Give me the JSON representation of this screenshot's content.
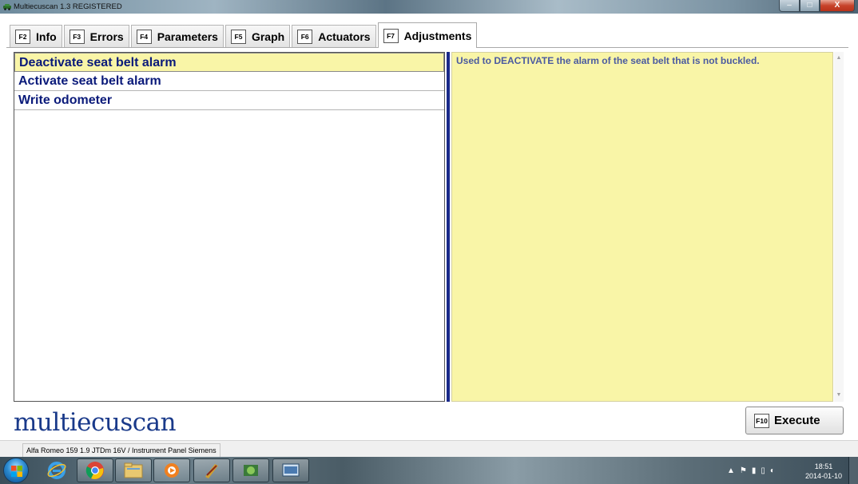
{
  "window": {
    "title": "Multiecuscan 1.3 REGISTERED",
    "minimize": "–",
    "maximize": "□",
    "close": "X"
  },
  "tabs": [
    {
      "key": "F2",
      "label": "Info"
    },
    {
      "key": "F3",
      "label": "Errors"
    },
    {
      "key": "F4",
      "label": "Parameters"
    },
    {
      "key": "F5",
      "label": "Graph"
    },
    {
      "key": "F6",
      "label": "Actuators"
    },
    {
      "key": "F7",
      "label": "Adjustments",
      "active": true
    }
  ],
  "adjustments": [
    {
      "label": "Deactivate seat belt alarm",
      "selected": true
    },
    {
      "label": "Activate seat belt alarm"
    },
    {
      "label": "Write odometer"
    }
  ],
  "description": "Used to DEACTIVATE the alarm of the seat belt that is not buckled.",
  "logo": "multiecuscan",
  "execute": {
    "key": "F10",
    "label": "Execute"
  },
  "status": {
    "vehicle": "Alfa Romeo 159 1.9 JTDm 16V / Instrument Panel Siemens"
  },
  "taskbar": {
    "items": [
      "internet-explorer-icon",
      "chrome-icon",
      "file-explorer-icon",
      "media-player-icon",
      "app-icon",
      "app-icon",
      "app-icon"
    ],
    "clock": {
      "time": "18:51",
      "date": "2014-01-10"
    }
  },
  "colors": {
    "selection": "#f9f5a7",
    "list_text": "#0a1a7a",
    "logo": "#1a3a8a",
    "splitter": "#1a2a8a"
  }
}
